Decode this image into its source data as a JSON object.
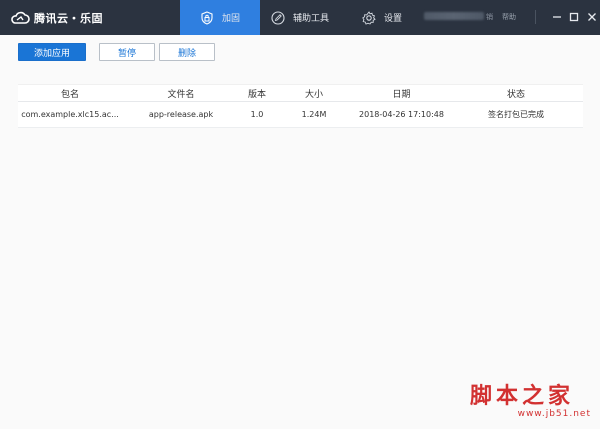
{
  "titlebar": {
    "brand": "腾讯云・乐固",
    "tabs": [
      {
        "label": "加固",
        "icon": "shield-lock-icon",
        "active": true
      },
      {
        "label": "辅助工具",
        "icon": "pencil-circle-icon",
        "active": false
      },
      {
        "label": "设置",
        "icon": "gear-icon",
        "active": false
      }
    ],
    "account_suffix": "销",
    "help": "帮助",
    "active_color": "#2f7fe0",
    "bg_color": "#2b3340"
  },
  "toolbar": {
    "add_app": "添加应用",
    "pause": "暂停",
    "delete": "删除"
  },
  "table": {
    "headers": [
      "包名",
      "文件名",
      "版本",
      "大小",
      "日期",
      "状态"
    ],
    "rows": [
      {
        "package": "com.example.xlc15.ac...",
        "filename": "app-release.apk",
        "version": "1.0",
        "size": "1.24M",
        "date": "2018-04-26 17:10:48",
        "status": "签名打包已完成"
      }
    ]
  },
  "watermark": {
    "big": "脚本之家",
    "small": "www.jb51.net"
  }
}
